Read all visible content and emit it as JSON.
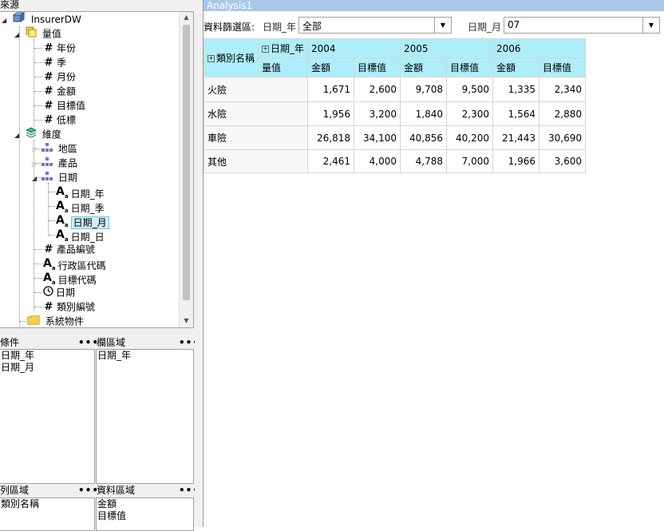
{
  "left": {
    "resource_header": "來源",
    "tree": {
      "root": "InsurerDW",
      "measures_folder": "量值",
      "measures": [
        "年份",
        "季",
        "月份",
        "金額",
        "目標值",
        "低標"
      ],
      "dimensions_folder": "維度",
      "dimensions": [
        "地區",
        "產品",
        "日期"
      ],
      "date_levels": [
        "日期_年",
        "日期_季",
        "日期_月",
        "日期_日"
      ],
      "selected": "日期_月",
      "dim_fields": [
        {
          "icon": "hash-icon",
          "label": "產品編號"
        },
        {
          "icon": "text-attribute-icon",
          "label": "行政區代碼"
        },
        {
          "icon": "text-attribute-icon",
          "label": "目標代碼"
        },
        {
          "icon": "clock-icon",
          "label": "日期"
        },
        {
          "icon": "hash-icon",
          "label": "類別編號"
        }
      ],
      "system_folder": "系統物件"
    },
    "zones": {
      "filter": {
        "title": "條件",
        "items": [
          "日期_年",
          "日期_月"
        ]
      },
      "column": {
        "title": "欄區域",
        "items": [
          "日期_年"
        ]
      },
      "row": {
        "title": "列區域",
        "items": [
          "類別名稱"
        ]
      },
      "data": {
        "title": "資料區域",
        "items": [
          "金額",
          "目標值"
        ]
      },
      "menu_glyph": "•••"
    }
  },
  "analysis": {
    "tab_title": "Analysis1",
    "filter_label": "資料篩選區:",
    "filters": [
      {
        "label": "日期_年",
        "value": "全部"
      },
      {
        "label": "日期_月",
        "value": "07"
      }
    ],
    "pivot": {
      "row_field": "類別名稱",
      "col_field": "日期_年",
      "measure_header": "量值",
      "years": [
        "2004",
        "2005",
        "2006"
      ],
      "measures": [
        "金額",
        "目標值"
      ],
      "rows": [
        {
          "name": "火險",
          "values": [
            "1,671",
            "2,600",
            "9,708",
            "9,500",
            "1,335",
            "2,340"
          ]
        },
        {
          "name": "水險",
          "values": [
            "1,956",
            "3,200",
            "1,840",
            "2,300",
            "1,564",
            "2,880"
          ]
        },
        {
          "name": "車險",
          "values": [
            "26,818",
            "34,100",
            "40,856",
            "40,200",
            "21,443",
            "30,690"
          ]
        },
        {
          "name": "其他",
          "values": [
            "2,461",
            "4,000",
            "4,788",
            "7,000",
            "1,966",
            "3,600"
          ]
        }
      ]
    }
  }
}
